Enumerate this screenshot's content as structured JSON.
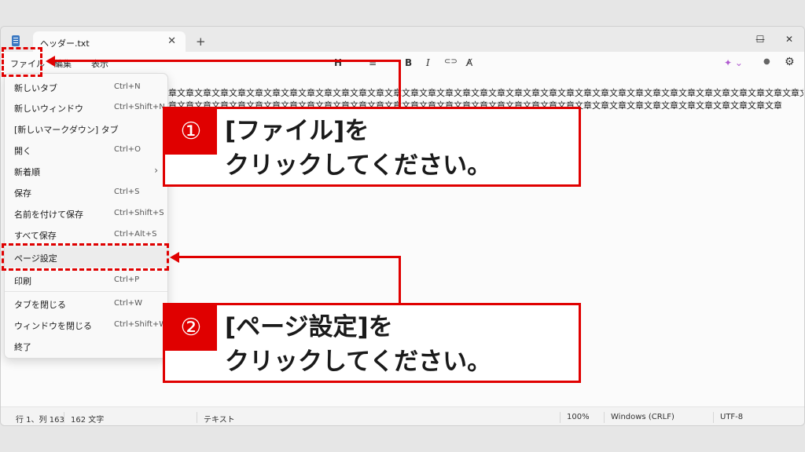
{
  "window": {
    "tab_title": "ヘッダー.txt",
    "tab_close": "✕",
    "new_tab": "+",
    "minimize": "—",
    "maximize": "☐",
    "close": "✕"
  },
  "menubar": {
    "file": "ファイル",
    "edit": "編集",
    "view": "表示",
    "heading": "H",
    "list": "≡",
    "bold": "B",
    "italic": "I",
    "link": "⊂⊃",
    "clear_format": "A̸",
    "copilot": "✦ ⌄",
    "account": "●",
    "settings": "⚙"
  },
  "editor": {
    "line1": "章文章文章文章文章文章文章文章文章文章文章文章文章文章文章文章文章文章文章文章文章文章文章文章文章文章文章文章文章文章文章文章文章文章文章文章文章文章文章文章",
    "line2": "章文章文章文章文章文章文章文章文章文章文章文章文章文章文章文章文章文章文章文章文章文章文章文章文章文章文章文章文章文章文章文章文章文章文章文章文章文章文章文章文章文章文章文章文章文章文章文章文章文章文章文章"
  },
  "file_menu": {
    "items": [
      {
        "label": "新しいタブ",
        "shortcut": "Ctrl+N"
      },
      {
        "label": "新しいウィンドウ",
        "shortcut": "Ctrl+Shift+N"
      },
      {
        "label": "[新しいマークダウン] タブ",
        "shortcut": ""
      },
      {
        "label": "開く",
        "shortcut": "Ctrl+O"
      },
      {
        "label": "新着順",
        "shortcut": "",
        "arrow": "›"
      },
      {
        "label": "保存",
        "shortcut": "Ctrl+S"
      },
      {
        "label": "名前を付けて保存",
        "shortcut": "Ctrl+Shift+S"
      },
      {
        "label": "すべて保存",
        "shortcut": "Ctrl+Alt+S"
      },
      {
        "label": "ページ設定",
        "shortcut": ""
      },
      {
        "label": "印刷",
        "shortcut": "Ctrl+P"
      },
      {
        "label": "タブを閉じる",
        "shortcut": "Ctrl+W"
      },
      {
        "label": "ウィンドウを閉じる",
        "shortcut": "Ctrl+Shift+W"
      },
      {
        "label": "終了",
        "shortcut": ""
      }
    ]
  },
  "statusbar": {
    "position": "行 1、列 163",
    "char_count": "162 文字",
    "format": "テキスト",
    "zoom": "100%",
    "line_ending": "Windows (CRLF)",
    "encoding": "UTF-8"
  },
  "callouts": {
    "step1_badge": "①",
    "step1_line1": "[ファイル]を",
    "step1_line2": "クリックしてください。",
    "step2_badge": "②",
    "step2_line1": "[ページ設定]を",
    "step2_line2": "クリックしてください。"
  },
  "colors": {
    "annotation": "#e00000",
    "window_bg": "#f3f3f3",
    "editor_bg": "#fbfbfb"
  }
}
